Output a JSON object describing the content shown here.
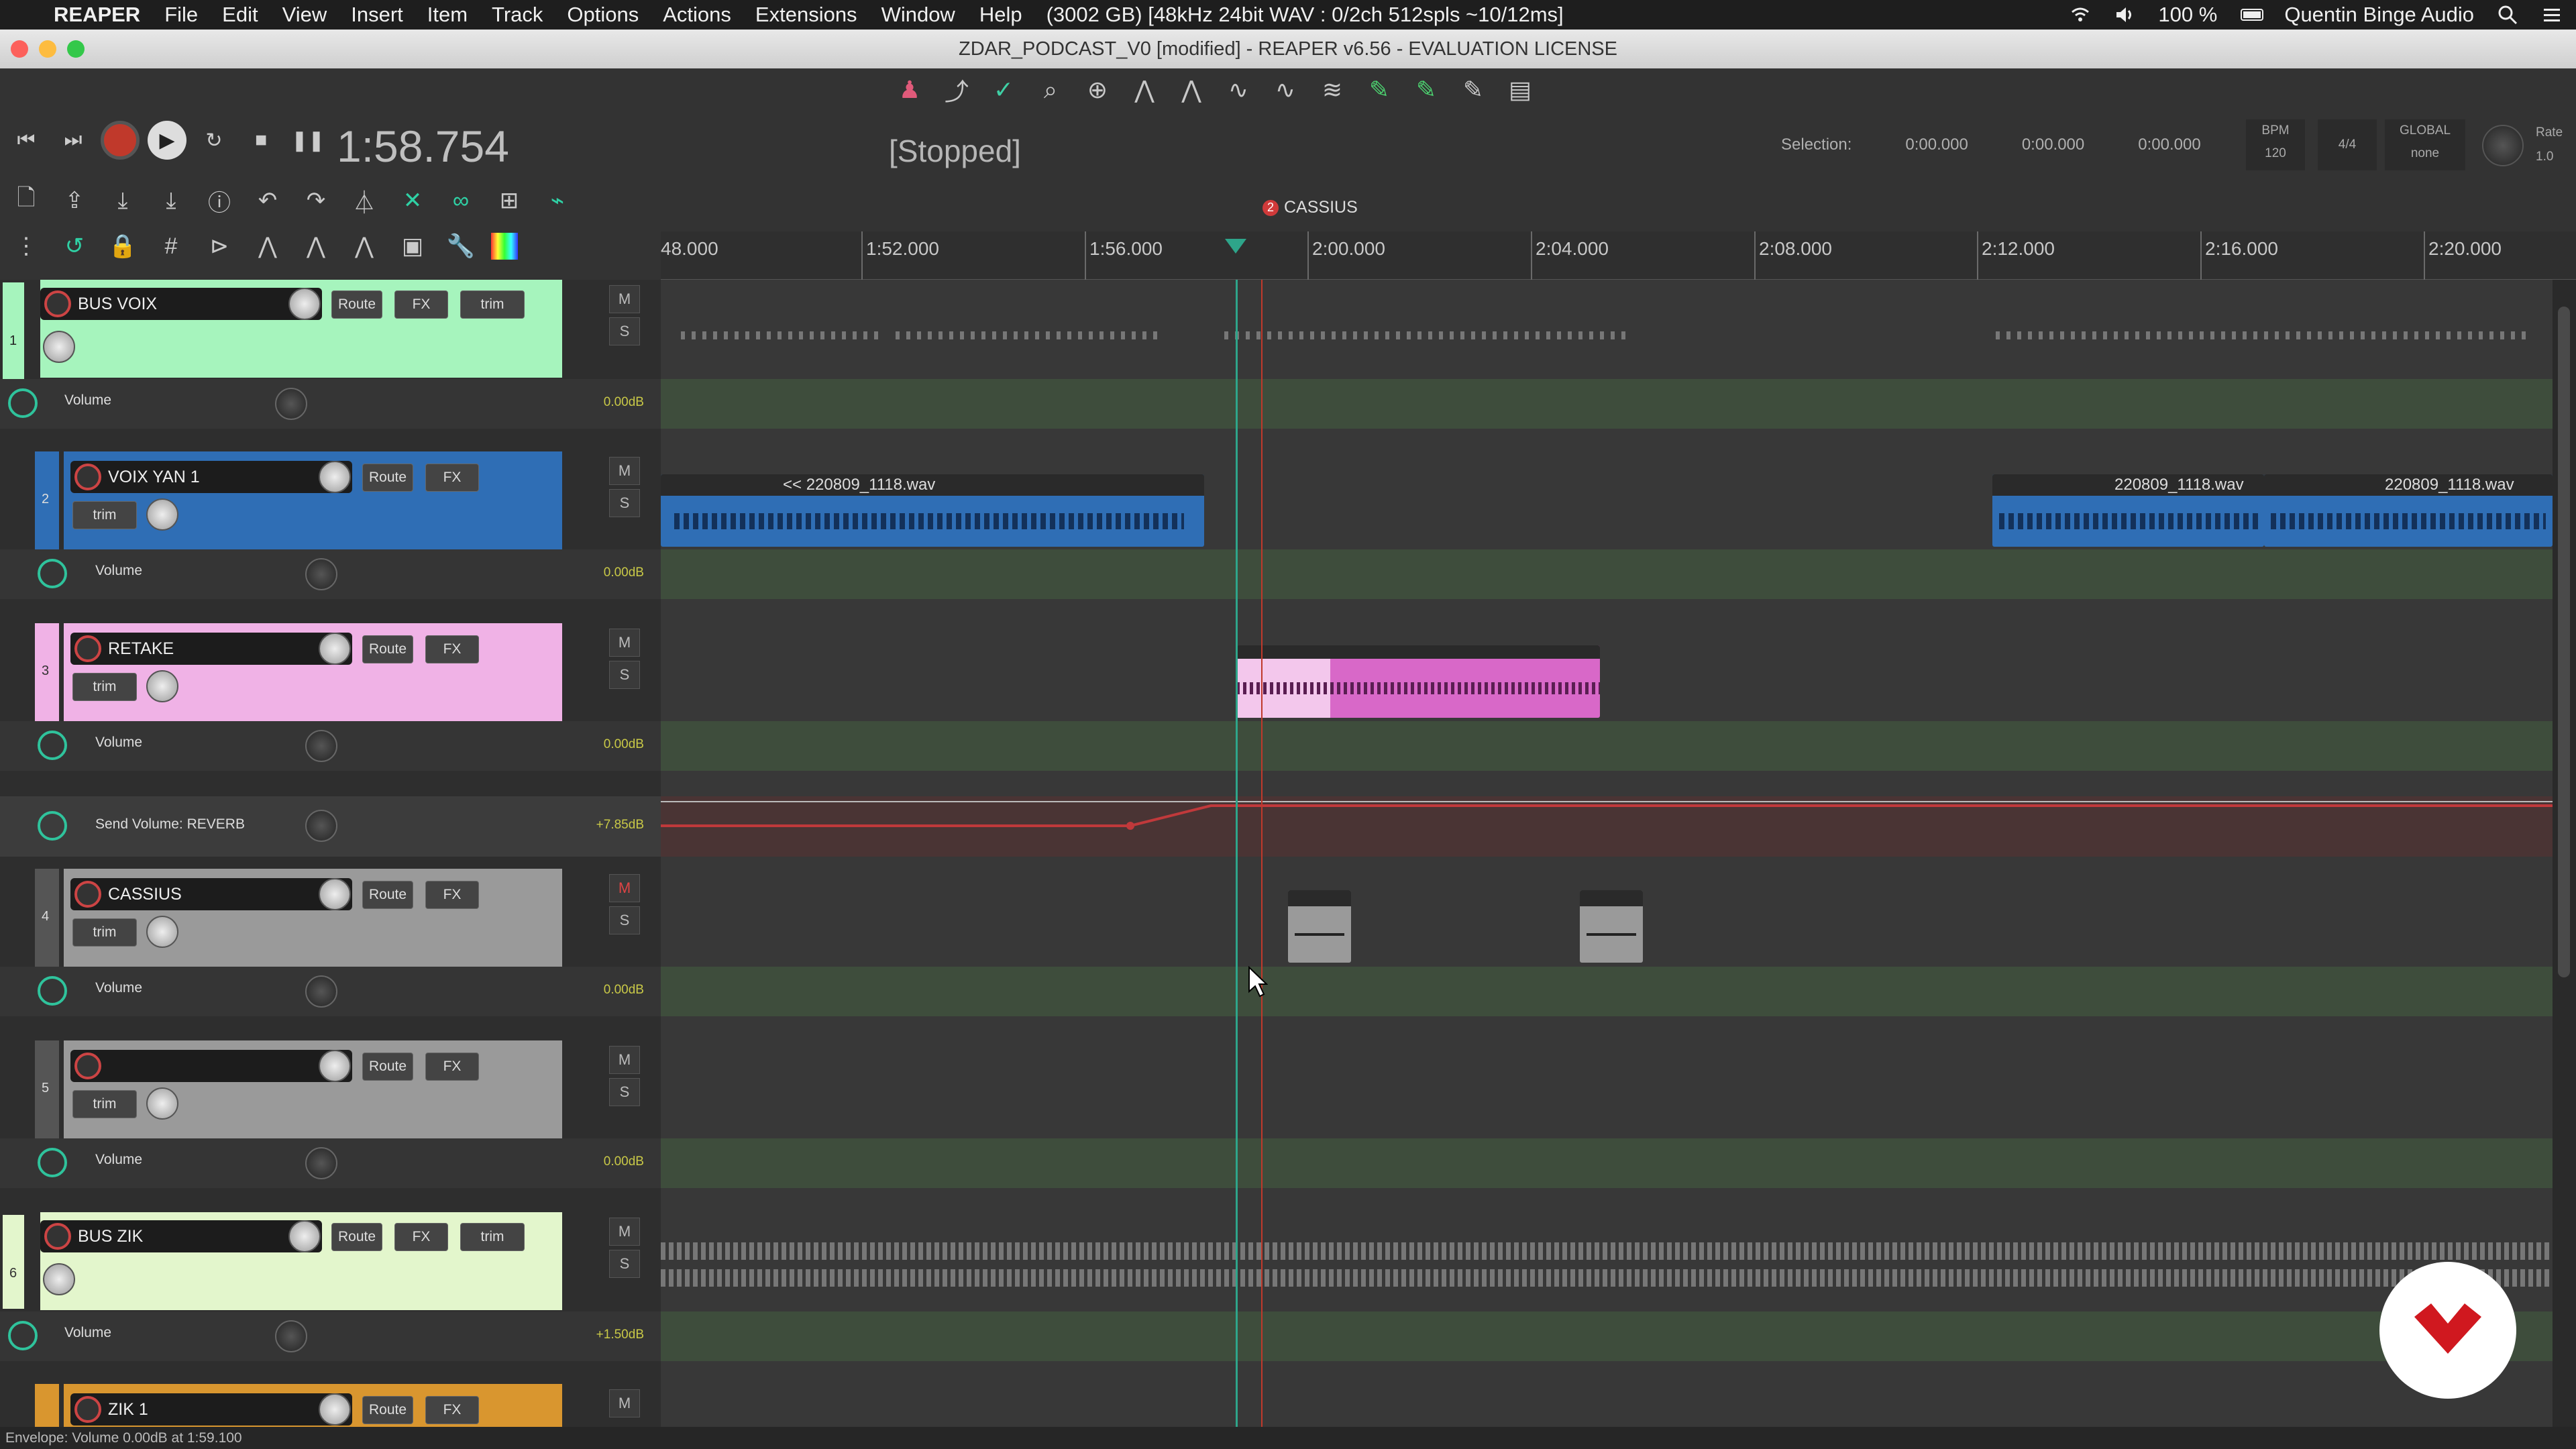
{
  "menubar": {
    "apple_glyph": "",
    "items": [
      "REAPER",
      "File",
      "Edit",
      "View",
      "Insert",
      "Item",
      "Track",
      "Options",
      "Actions",
      "Extensions",
      "Window",
      "Help"
    ],
    "status": "(3002 GB) [48kHz 24bit WAV : 0/2ch 512spls ~10/12ms]",
    "battery": "100 %",
    "user": "Quentin Binge Audio"
  },
  "window": {
    "title": "ZDAR_PODCAST_V0 [modified] - REAPER v6.56 - EVALUATION LICENSE"
  },
  "transport": {
    "time": "1:58.754",
    "state": "[Stopped]",
    "selection_label": "Selection:",
    "sel_start": "0:00.000",
    "sel_end": "0:00.000",
    "sel_len": "0:00.000",
    "bpm_label": "BPM",
    "bpm_value": "120",
    "timesig": "4/4",
    "global_label": "GLOBAL",
    "global_value": "none",
    "rate_label": "Rate",
    "rate_value": "1.0"
  },
  "ruler": {
    "labels": [
      "48.000",
      "1:52.000",
      "1:56.000",
      "2:00.000",
      "2:04.000",
      "2:08.000",
      "2:12.000",
      "2:16.000",
      "2:20.000"
    ],
    "marker_num": "2",
    "marker_name": "CASSIUS"
  },
  "tracks": [
    {
      "num": "1",
      "name": "BUS VOIX",
      "color": "#a6f4bd",
      "env": "Volume",
      "env_val": "0.00dB"
    },
    {
      "num": "2",
      "name": "VOIX YAN 1",
      "color": "#2f6eb5",
      "env": "Volume",
      "env_val": "0.00dB"
    },
    {
      "num": "3",
      "name": "RETAKE",
      "color": "#f0b2e6",
      "env": "Volume",
      "env_val": "0.00dB",
      "send": "Send Volume: REVERB",
      "send_val": "+7.85dB"
    },
    {
      "num": "4",
      "name": "CASSIUS",
      "color": "#9a9a9a",
      "env": "Volume",
      "env_val": "0.00dB"
    },
    {
      "num": "5",
      "name": "",
      "color": "#9a9a9a",
      "env": "Volume",
      "env_val": "0.00dB"
    },
    {
      "num": "6",
      "name": "BUS ZIK",
      "color": "#e3f6cc",
      "env": "Volume",
      "env_val": "+1.50dB"
    },
    {
      "num": "",
      "name": "ZIK 1",
      "color": "#d9962f"
    }
  ],
  "labels": {
    "route": "Route",
    "fx": "FX",
    "trim": "trim",
    "mute": "M",
    "solo": "S"
  },
  "items": {
    "voix_left": "<< 220809_1118.wav",
    "voix_right1": "220809_1118.wav",
    "voix_right2": "220809_1118.wav"
  },
  "status": "Envelope: Volume 0.00dB at 1:59.100"
}
